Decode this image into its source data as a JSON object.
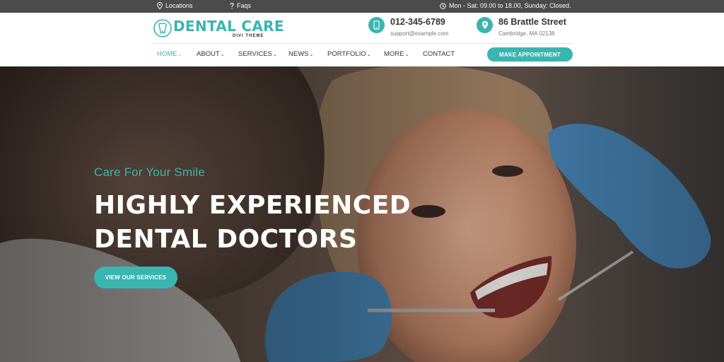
{
  "topbar": {
    "locations": "Locations",
    "faqs": "Faqs",
    "hours": "Mon - Sat: 09.00 to 18.00, Sunday: Closed."
  },
  "logo": {
    "name": "DENTAL CARE",
    "subtitle": "DIVI THEME"
  },
  "contact": {
    "phone": "012-345-6789",
    "email": "support@example.com",
    "street": "86 Brattle Street",
    "city": "Cambridge, MA 02138"
  },
  "nav": {
    "items": [
      {
        "label": "HOME",
        "caret": "⌄"
      },
      {
        "label": "ABOUT",
        "caret": "⌄"
      },
      {
        "label": "SERVICES",
        "caret": "⌄"
      },
      {
        "label": "NEWS",
        "caret": "⌄"
      },
      {
        "label": "PORTFOLIO",
        "caret": "⌄"
      },
      {
        "label": "MORE",
        "caret": "⌄"
      },
      {
        "label": "CONTACT",
        "caret": ""
      }
    ],
    "cta": "MAKE APPOINTMENT"
  },
  "hero": {
    "tagline": "Care For Your Smile",
    "headline_line1": "HIGHLY EXPERIENCED",
    "headline_line2": "DENTAL DOCTORS",
    "button": "VIEW OUR SERVICES"
  },
  "colors": {
    "accent": "#3ab5b0",
    "topbar_bg": "#4b4b4b",
    "text_dark": "#333333"
  },
  "icons": [
    "map-pin-icon",
    "help-icon",
    "clock-icon",
    "tooth-icon",
    "phone-icon",
    "location-icon",
    "caret-down-icon"
  ]
}
